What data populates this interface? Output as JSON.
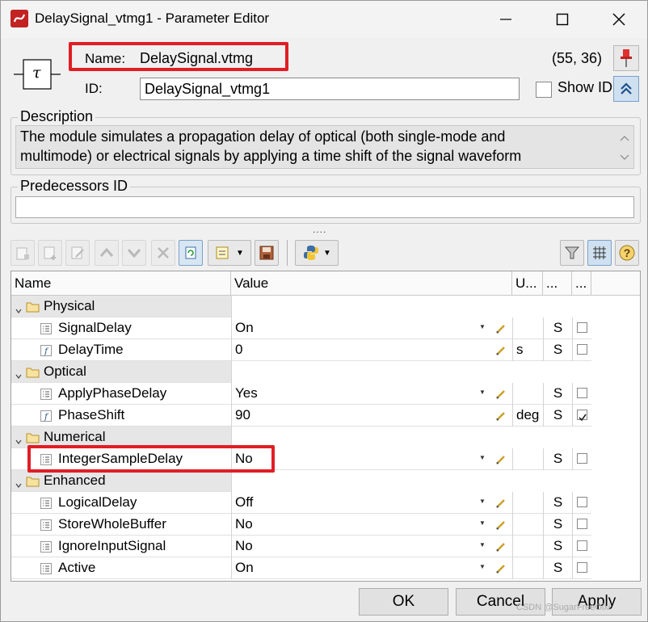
{
  "window": {
    "title": "DelaySignal_vtmg1 - Parameter Editor"
  },
  "header": {
    "name_label": "Name:",
    "name_value": "DelaySignal.vtmg",
    "coords": "(55, 36)",
    "id_label": "ID:",
    "id_value": "DelaySignal_vtmg1",
    "show_id_label": "Show ID",
    "module_symbol": "τ"
  },
  "description": {
    "title": "Description",
    "text_line1": "The module simulates a propagation delay of optical (both single-mode and",
    "text_line2": "multimode) or electrical signals by applying a time shift of the signal waveform"
  },
  "predecessors": {
    "title": "Predecessors ID",
    "value": ""
  },
  "splitter": "....",
  "grid": {
    "columns": [
      "Name",
      "Value",
      "U...",
      "...",
      "..."
    ],
    "rows": [
      {
        "type": "category",
        "name": "Physical"
      },
      {
        "type": "param",
        "name": "SignalDelay",
        "value": "On",
        "unit": "",
        "s": "S",
        "dropdown": true,
        "icon": "list",
        "checked": false
      },
      {
        "type": "param",
        "name": "DelayTime",
        "value": "0",
        "unit": "s",
        "s": "S",
        "dropdown": false,
        "icon": "f",
        "checked": false
      },
      {
        "type": "category",
        "name": "Optical"
      },
      {
        "type": "param",
        "name": "ApplyPhaseDelay",
        "value": "Yes",
        "unit": "",
        "s": "S",
        "dropdown": true,
        "icon": "list",
        "checked": false
      },
      {
        "type": "param",
        "name": "PhaseShift",
        "value": "90",
        "unit": "deg",
        "s": "S",
        "dropdown": false,
        "icon": "f",
        "checked": true
      },
      {
        "type": "category",
        "name": "Numerical"
      },
      {
        "type": "param",
        "name": "IntegerSampleDelay",
        "value": "No",
        "unit": "",
        "s": "S",
        "dropdown": true,
        "icon": "list",
        "checked": false
      },
      {
        "type": "category",
        "name": "Enhanced"
      },
      {
        "type": "param",
        "name": "LogicalDelay",
        "value": "Off",
        "unit": "",
        "s": "S",
        "dropdown": true,
        "icon": "list",
        "checked": false
      },
      {
        "type": "param",
        "name": "StoreWholeBuffer",
        "value": "No",
        "unit": "",
        "s": "S",
        "dropdown": true,
        "icon": "list",
        "checked": false
      },
      {
        "type": "param",
        "name": "IgnoreInputSignal",
        "value": "No",
        "unit": "",
        "s": "S",
        "dropdown": true,
        "icon": "list",
        "checked": false
      },
      {
        "type": "param",
        "name": "Active",
        "value": "On",
        "unit": "",
        "s": "S",
        "dropdown": true,
        "icon": "list",
        "checked": false
      }
    ]
  },
  "buttons": {
    "ok": "OK",
    "cancel": "Cancel",
    "apply": "Apply"
  },
  "watermark": "CSDN @SugarFreeOixi",
  "colors": {
    "highlight_red": "#e11d25",
    "category_bg": "#e6e6e6",
    "app_icon": "#c22222"
  }
}
